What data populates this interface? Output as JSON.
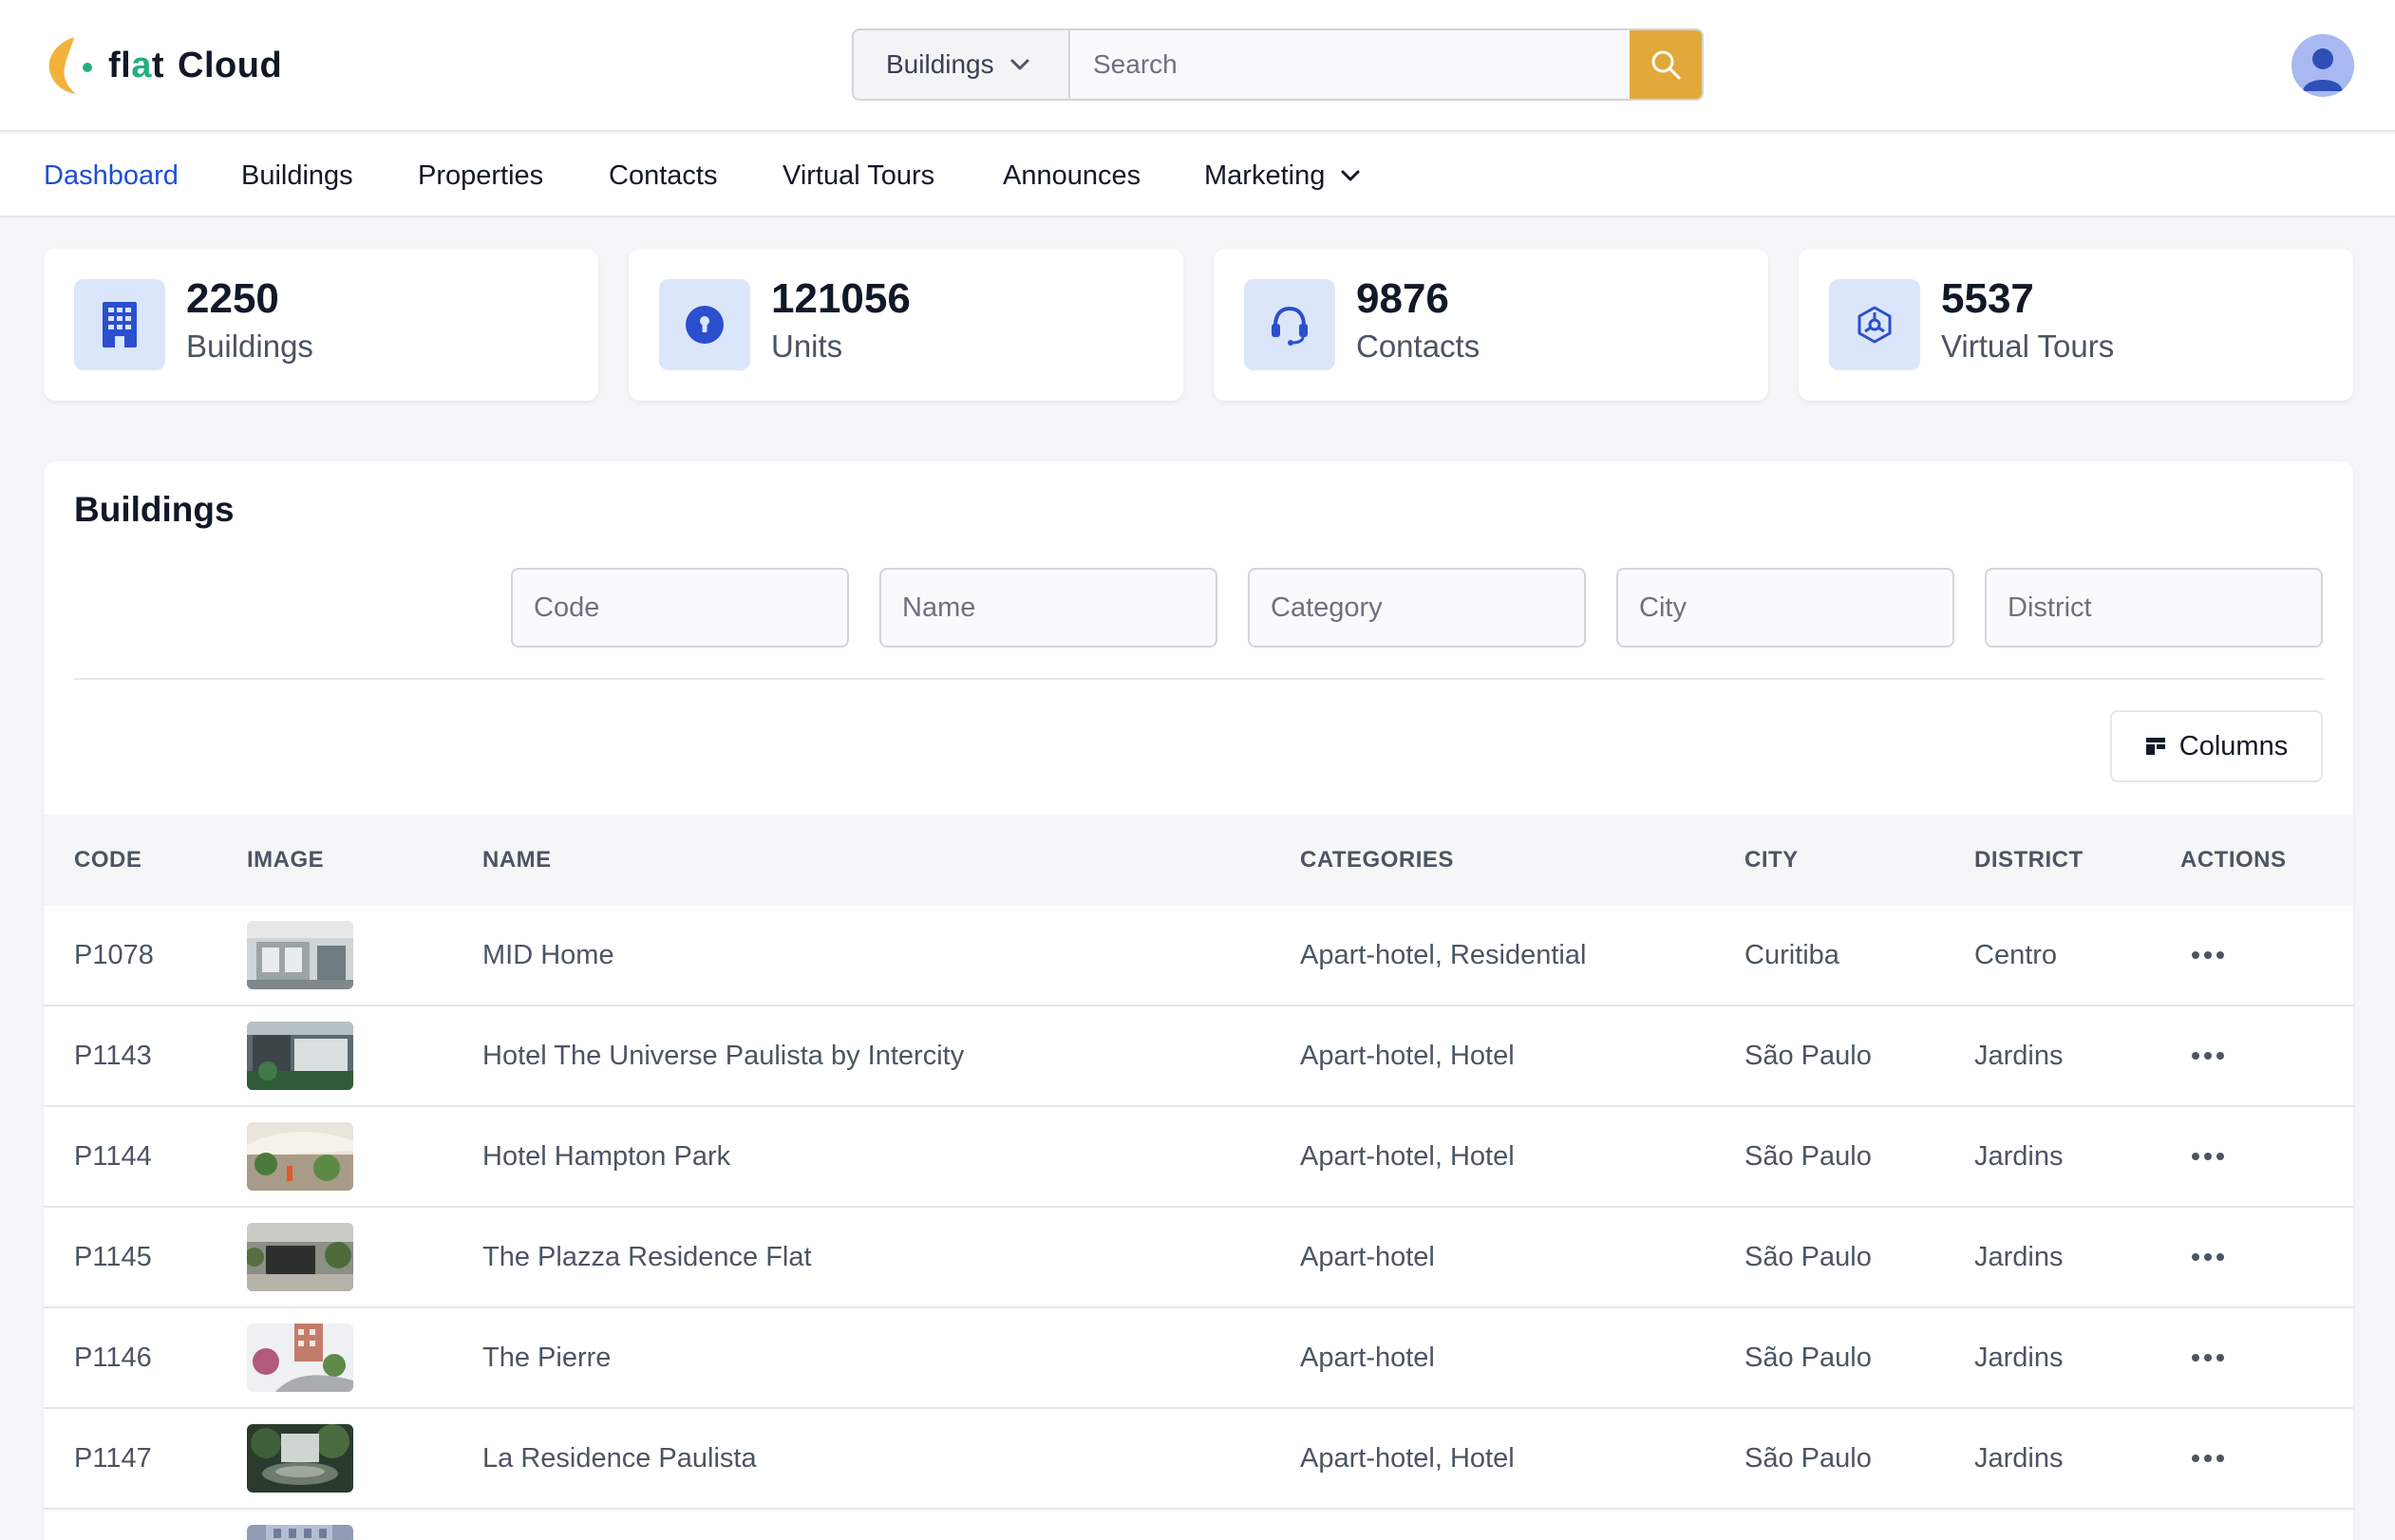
{
  "brand": {
    "name_prefix": "fl",
    "name_a": "a",
    "name_t": "t",
    "name_suffix": "Cloud",
    "accent": "#e1a93a",
    "active_blue": "#1d4ed8"
  },
  "search": {
    "scope": "Buildings",
    "placeholder": "Search"
  },
  "nav": {
    "items": [
      {
        "label": "Dashboard",
        "active": true
      },
      {
        "label": "Buildings"
      },
      {
        "label": "Properties"
      },
      {
        "label": "Contacts"
      },
      {
        "label": "Virtual Tours"
      },
      {
        "label": "Announces"
      },
      {
        "label": "Marketing",
        "has_dropdown": true
      }
    ]
  },
  "stats": [
    {
      "value": "2250",
      "label": "Buildings",
      "icon": "building-icon"
    },
    {
      "value": "121056",
      "label": "Units",
      "icon": "keyhole-icon"
    },
    {
      "value": "9876",
      "label": "Contacts",
      "icon": "headset-icon"
    },
    {
      "value": "5537",
      "label": "Virtual Tours",
      "icon": "tour-360-icon"
    }
  ],
  "buildings": {
    "title": "Buildings",
    "filters": {
      "code": "Code",
      "name": "Name",
      "category": "Category",
      "city": "City",
      "district": "District"
    },
    "columns_button": "Columns",
    "headers": {
      "code": "CODE",
      "image": "IMAGE",
      "name": "NAME",
      "categories": "CATEGORIES",
      "city": "CITY",
      "district": "DISTRICT",
      "actions": "ACTIONS"
    },
    "rows": [
      {
        "code": "P1078",
        "name": "MID Home",
        "categories": "Apart-hotel, Residential",
        "city": "Curitiba",
        "district": "Centro"
      },
      {
        "code": "P1143",
        "name": "Hotel The Universe Paulista by Intercity",
        "categories": "Apart-hotel, Hotel",
        "city": "São Paulo",
        "district": "Jardins"
      },
      {
        "code": "P1144",
        "name": "Hotel Hampton Park",
        "categories": "Apart-hotel, Hotel",
        "city": "São Paulo",
        "district": "Jardins"
      },
      {
        "code": "P1145",
        "name": "The Plazza Residence Flat",
        "categories": "Apart-hotel",
        "city": "São Paulo",
        "district": "Jardins"
      },
      {
        "code": "P1146",
        "name": "The Pierre",
        "categories": "Apart-hotel",
        "city": "São Paulo",
        "district": "Jardins"
      },
      {
        "code": "P1147",
        "name": "La Residence Paulista",
        "categories": "Apart-hotel, Hotel",
        "city": "São Paulo",
        "district": "Jardins"
      }
    ]
  }
}
